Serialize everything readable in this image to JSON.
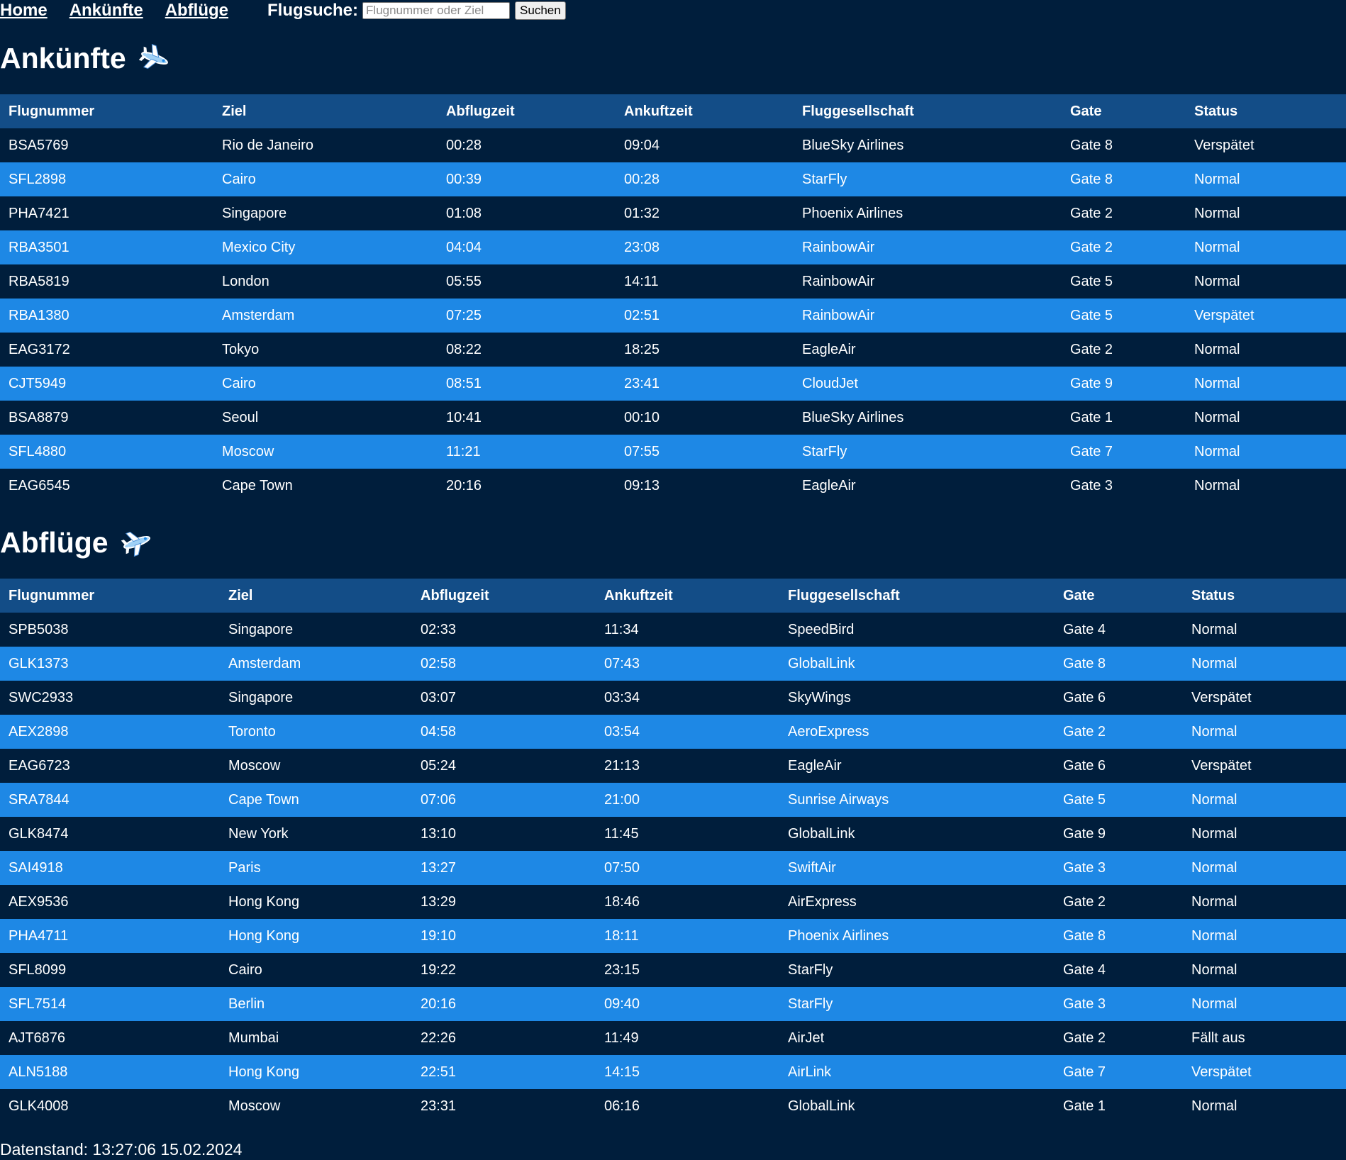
{
  "nav": {
    "links": [
      "Home",
      "Ankünfte",
      "Abflüge"
    ],
    "search_label": "Flugsuche:",
    "search_placeholder": "Flugnummer oder Ziel",
    "search_button": "Suchen"
  },
  "columns": [
    "Flugnummer",
    "Ziel",
    "Abflugzeit",
    "Ankuftzeit",
    "Fluggesellschaft",
    "Gate",
    "Status"
  ],
  "arrivals": {
    "title": "Ankünfte",
    "icon": "airplane-icon",
    "rows": [
      [
        "BSA5769",
        "Rio de Janeiro",
        "00:28",
        "09:04",
        "BlueSky Airlines",
        "Gate 8",
        "Verspätet"
      ],
      [
        "SFL2898",
        "Cairo",
        "00:39",
        "00:28",
        "StarFly",
        "Gate 8",
        "Normal"
      ],
      [
        "PHA7421",
        "Singapore",
        "01:08",
        "01:32",
        "Phoenix Airlines",
        "Gate 2",
        "Normal"
      ],
      [
        "RBA3501",
        "Mexico City",
        "04:04",
        "23:08",
        "RainbowAir",
        "Gate 2",
        "Normal"
      ],
      [
        "RBA5819",
        "London",
        "05:55",
        "14:11",
        "RainbowAir",
        "Gate 5",
        "Normal"
      ],
      [
        "RBA1380",
        "Amsterdam",
        "07:25",
        "02:51",
        "RainbowAir",
        "Gate 5",
        "Verspätet"
      ],
      [
        "EAG3172",
        "Tokyo",
        "08:22",
        "18:25",
        "EagleAir",
        "Gate 2",
        "Normal"
      ],
      [
        "CJT5949",
        "Cairo",
        "08:51",
        "23:41",
        "CloudJet",
        "Gate 9",
        "Normal"
      ],
      [
        "BSA8879",
        "Seoul",
        "10:41",
        "00:10",
        "BlueSky Airlines",
        "Gate 1",
        "Normal"
      ],
      [
        "SFL4880",
        "Moscow",
        "11:21",
        "07:55",
        "StarFly",
        "Gate 7",
        "Normal"
      ],
      [
        "EAG6545",
        "Cape Town",
        "20:16",
        "09:13",
        "EagleAir",
        "Gate 3",
        "Normal"
      ]
    ]
  },
  "departures": {
    "title": "Abflüge",
    "icon": "airplane-icon",
    "rows": [
      [
        "SPB5038",
        "Singapore",
        "02:33",
        "11:34",
        "SpeedBird",
        "Gate 4",
        "Normal"
      ],
      [
        "GLK1373",
        "Amsterdam",
        "02:58",
        "07:43",
        "GlobalLink",
        "Gate 8",
        "Normal"
      ],
      [
        "SWC2933",
        "Singapore",
        "03:07",
        "03:34",
        "SkyWings",
        "Gate 6",
        "Verspätet"
      ],
      [
        "AEX2898",
        "Toronto",
        "04:58",
        "03:54",
        "AeroExpress",
        "Gate 2",
        "Normal"
      ],
      [
        "EAG6723",
        "Moscow",
        "05:24",
        "21:13",
        "EagleAir",
        "Gate 6",
        "Verspätet"
      ],
      [
        "SRA7844",
        "Cape Town",
        "07:06",
        "21:00",
        "Sunrise Airways",
        "Gate 5",
        "Normal"
      ],
      [
        "GLK8474",
        "New York",
        "13:10",
        "11:45",
        "GlobalLink",
        "Gate 9",
        "Normal"
      ],
      [
        "SAI4918",
        "Paris",
        "13:27",
        "07:50",
        "SwiftAir",
        "Gate 3",
        "Normal"
      ],
      [
        "AEX9536",
        "Hong Kong",
        "13:29",
        "18:46",
        "AirExpress",
        "Gate 2",
        "Normal"
      ],
      [
        "PHA4711",
        "Hong Kong",
        "19:10",
        "18:11",
        "Phoenix Airlines",
        "Gate 8",
        "Normal"
      ],
      [
        "SFL8099",
        "Cairo",
        "19:22",
        "23:15",
        "StarFly",
        "Gate 4",
        "Normal"
      ],
      [
        "SFL7514",
        "Berlin",
        "20:16",
        "09:40",
        "StarFly",
        "Gate 3",
        "Normal"
      ],
      [
        "AJT6876",
        "Mumbai",
        "22:26",
        "11:49",
        "AirJet",
        "Gate 2",
        "Fällt aus"
      ],
      [
        "ALN5188",
        "Hong Kong",
        "22:51",
        "14:15",
        "AirLink",
        "Gate 7",
        "Verspätet"
      ],
      [
        "GLK4008",
        "Moscow",
        "23:31",
        "06:16",
        "GlobalLink",
        "Gate 1",
        "Normal"
      ]
    ]
  },
  "footer": {
    "text": "Datenstand: 13:27:06 15.02.2024"
  },
  "colors": {
    "background": "#001e3c",
    "header_row": "#134d87",
    "stripe": "#1e88e5",
    "text": "#ffffff"
  }
}
